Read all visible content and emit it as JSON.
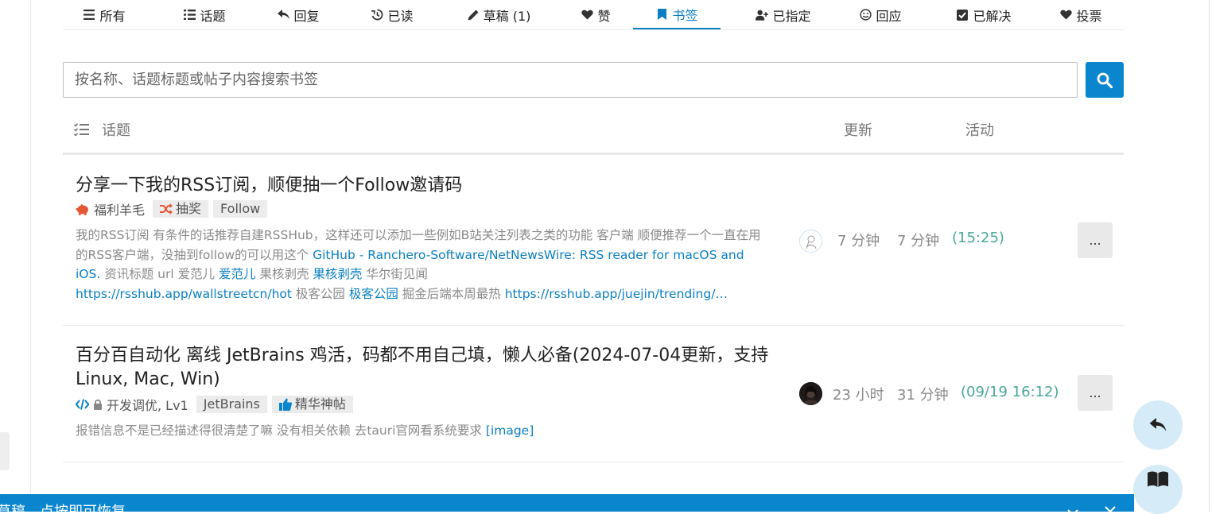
{
  "tabs": [
    {
      "label": "所有",
      "icon": "list-icon"
    },
    {
      "label": "话题",
      "icon": "list-bullets-icon"
    },
    {
      "label": "回复",
      "icon": "reply-icon"
    },
    {
      "label": "已读",
      "icon": "history-icon"
    },
    {
      "label": "草稿 (1)",
      "icon": "pencil-icon"
    },
    {
      "label": "赞",
      "icon": "heart-icon"
    },
    {
      "label": "书签",
      "icon": "bookmark-icon",
      "active": true
    },
    {
      "label": "已指定",
      "icon": "user-plus-icon"
    },
    {
      "label": "回应",
      "icon": "smile-icon"
    },
    {
      "label": "已解决",
      "icon": "check-square-icon"
    },
    {
      "label": "投票",
      "icon": "heart-icon"
    }
  ],
  "search": {
    "placeholder": "按名称、话题标题或帖子内容搜索书签"
  },
  "list_header": {
    "topic": "话题",
    "updated": "更新",
    "activity": "活动"
  },
  "rows": [
    {
      "title": "分享一下我的RSS订阅，顺便抽一个Follow邀请码",
      "category": "福利羊毛",
      "tags": [
        "抽奖",
        "Follow"
      ],
      "excerpt": {
        "t1": "我的RSS订阅 有条件的话推荐自建RSSHub，这样还可以添加一些例如B站关注列表之类的功能 客户端 顺便推荐一个一直在用的RSS客户端，没抽到follow的可以用这个 ",
        "l1": "GitHub - Ranchero-Software/NetNewsWire: RSS reader for macOS and iOS.",
        "t2": " 资讯标题 url 爱范儿 ",
        "l2": "爱范儿",
        "t3": " 果核剥壳 ",
        "l3": "果核剥壳",
        "t4": " 华尔街见闻 ",
        "l4": "https://rsshub.app/wallstreetcn/hot",
        "t5": " 极客公园 ",
        "l5": "极客公园",
        "t6": " 掘金后端本周最热 ",
        "l6": "https://rsshub.app/juejin/trending/…"
      },
      "updated": "7 分钟",
      "activity": "7 分钟",
      "activity_time": "(15:25)",
      "more": "..."
    },
    {
      "title": "百分百自动化 离线 JetBrains 鸡活，码都不用自己填，懒人必备(2024-07-04更新，支持 Linux, Mac, Win)",
      "category": "开发调优, Lv1",
      "tags": [
        "JetBrains",
        "精华神帖"
      ],
      "excerpt": {
        "t1": "报错信息不是已经描述得很清楚了嘛 没有相关依赖 去tauri官网看系统要求 ",
        "l1": "[image]"
      },
      "updated": "23 小时",
      "activity": "31 分钟",
      "activity_time": "(09/19 16:12)",
      "more": "..."
    }
  ],
  "banner": {
    "text": "草稿，点按即可恢复"
  },
  "colors": {
    "accent": "#0a86cf",
    "teal": "#49a89a",
    "muted": "#8a8a8a"
  }
}
